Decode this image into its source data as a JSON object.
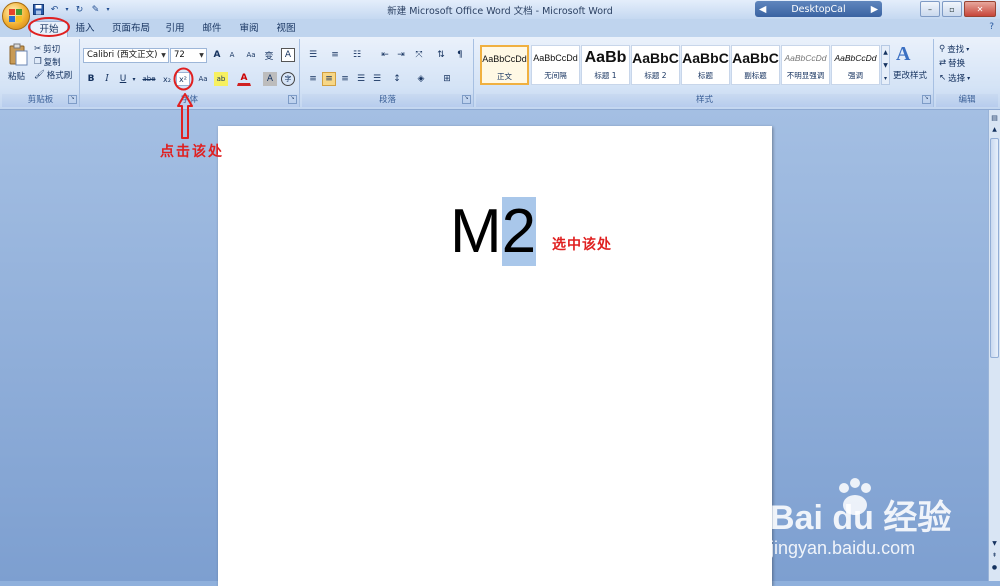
{
  "window": {
    "title": "新建 Microsoft Office Word 文档 - Microsoft Word",
    "desktopcal_label": "DesktopCal",
    "controls": [
      "–",
      "▫",
      "✕"
    ]
  },
  "tabs": [
    "开始",
    "插入",
    "页面布局",
    "引用",
    "邮件",
    "审阅",
    "视图"
  ],
  "clipboard": {
    "paste": "粘贴",
    "cut": "剪切",
    "copy": "复制",
    "format_painter": "格式刷",
    "label": "剪贴板"
  },
  "font": {
    "family": "Calibri (西文正文)",
    "size": "72",
    "label": "字体",
    "bold": "B",
    "italic": "I",
    "underline": "U",
    "strike": "abe",
    "subscript": "x₂",
    "superscript": "x²",
    "change_case": "Aa",
    "highlight": "ab",
    "font_color": "A",
    "char_shading": "A",
    "enclose": "字",
    "grow": "A",
    "shrink": "A",
    "clear": "Aa",
    "phonetic": "变",
    "border": "A"
  },
  "paragraph": {
    "label": "段落"
  },
  "styles": {
    "label": "样式",
    "items": [
      {
        "sample": "AaBbCcDd",
        "name": "正文"
      },
      {
        "sample": "AaBbCcDd",
        "name": "无间隔"
      },
      {
        "sample": "AaBb",
        "name": "标题 1"
      },
      {
        "sample": "AaBbC",
        "name": "标题 2"
      },
      {
        "sample": "AaBbC",
        "name": "标题"
      },
      {
        "sample": "AaBbC",
        "name": "副标题"
      },
      {
        "sample": "AaBbCcDd",
        "name": "不明显强调"
      },
      {
        "sample": "AaBbCcDd",
        "name": "强调"
      }
    ],
    "change_styles": "更改样式"
  },
  "editing": {
    "label": "编辑",
    "find": "查找",
    "replace": "替换",
    "select": "选择"
  },
  "document": {
    "text_before": "M",
    "text_selected": "2"
  },
  "annotations": {
    "click_here": "点击该处",
    "select_here": "选中该处"
  },
  "watermark": {
    "brand": "Bai du 经验",
    "url": "jingyan.baidu.com"
  },
  "colors": {
    "annotation_red": "#e02020",
    "selection_blue": "#a9c7ea"
  }
}
